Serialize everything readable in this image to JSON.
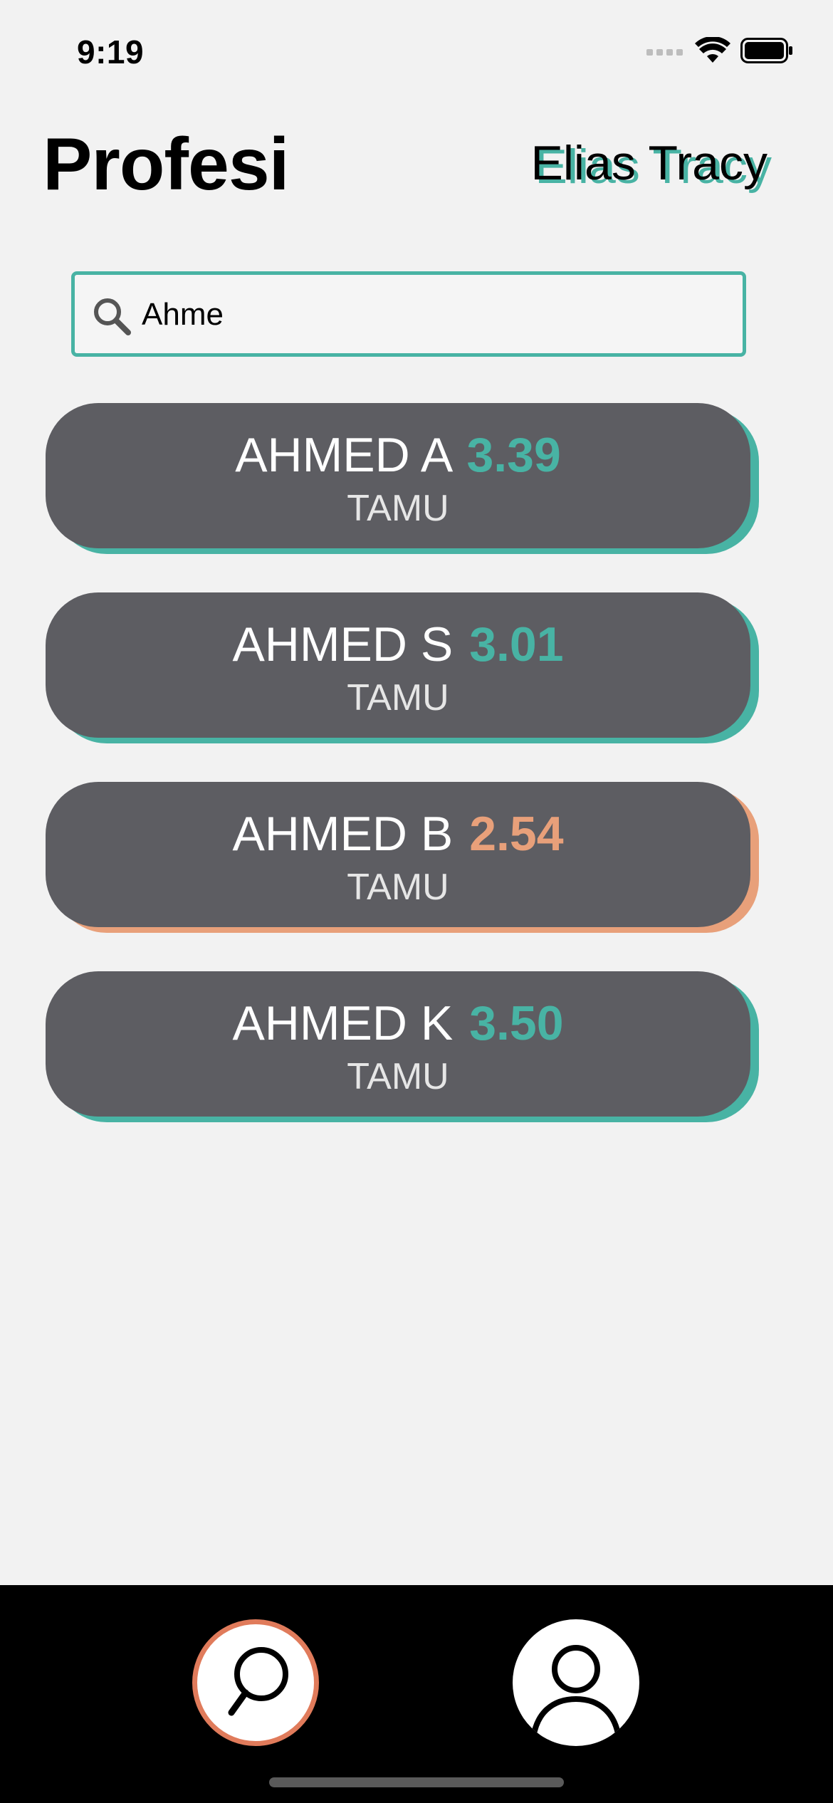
{
  "status_bar": {
    "time": "9:19",
    "icons": [
      "signal-icon",
      "wifi-icon",
      "battery-icon"
    ]
  },
  "header": {
    "title": "Profesi",
    "user_name": "Elias Tracy"
  },
  "search": {
    "value": "Ahme",
    "icon": "search-icon"
  },
  "results": [
    {
      "name": "AHMED A",
      "rating": "3.39",
      "school": "TAMU",
      "accent": "#48b3a4"
    },
    {
      "name": "AHMED S",
      "rating": "3.01",
      "school": "TAMU",
      "accent": "#48b3a4"
    },
    {
      "name": "AHMED B",
      "rating": "2.54",
      "school": "TAMU",
      "accent": "#e8a07a"
    },
    {
      "name": "AHMED K",
      "rating": "3.50",
      "school": "TAMU",
      "accent": "#48b3a4"
    }
  ],
  "tab_bar": {
    "tabs": [
      {
        "icon": "search-icon",
        "active": true
      },
      {
        "icon": "profile-icon",
        "active": false
      }
    ]
  },
  "colors": {
    "accent_teal": "#48b3a4",
    "accent_orange": "#e8a07a",
    "active_tab_ring": "#e07b5b",
    "card_bg": "#5d5d62",
    "page_bg": "#f2f2f2"
  }
}
